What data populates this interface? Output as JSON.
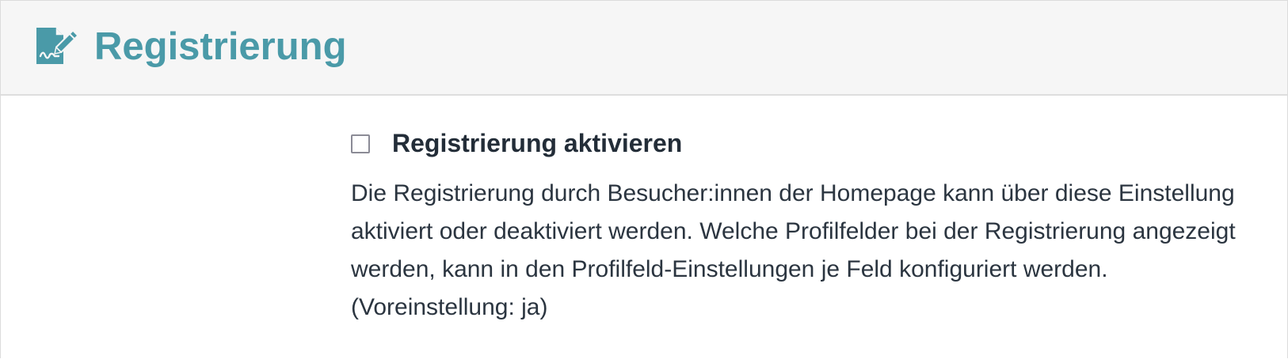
{
  "header": {
    "icon": "file-signature-icon",
    "title": "Registrierung",
    "accent_color": "#4a9aa8"
  },
  "setting": {
    "checkbox_checked": false,
    "label": "Registrierung aktivieren",
    "description": "Die Registrierung durch Besucher:innen der Homepage kann über diese Einstellung aktiviert oder deaktiviert werden. Welche Profilfelder bei der Registrierung angezeigt werden, kann in den Profilfeld-Einstellungen je Feld konfiguriert werden. (Voreinstellung: ja)"
  }
}
